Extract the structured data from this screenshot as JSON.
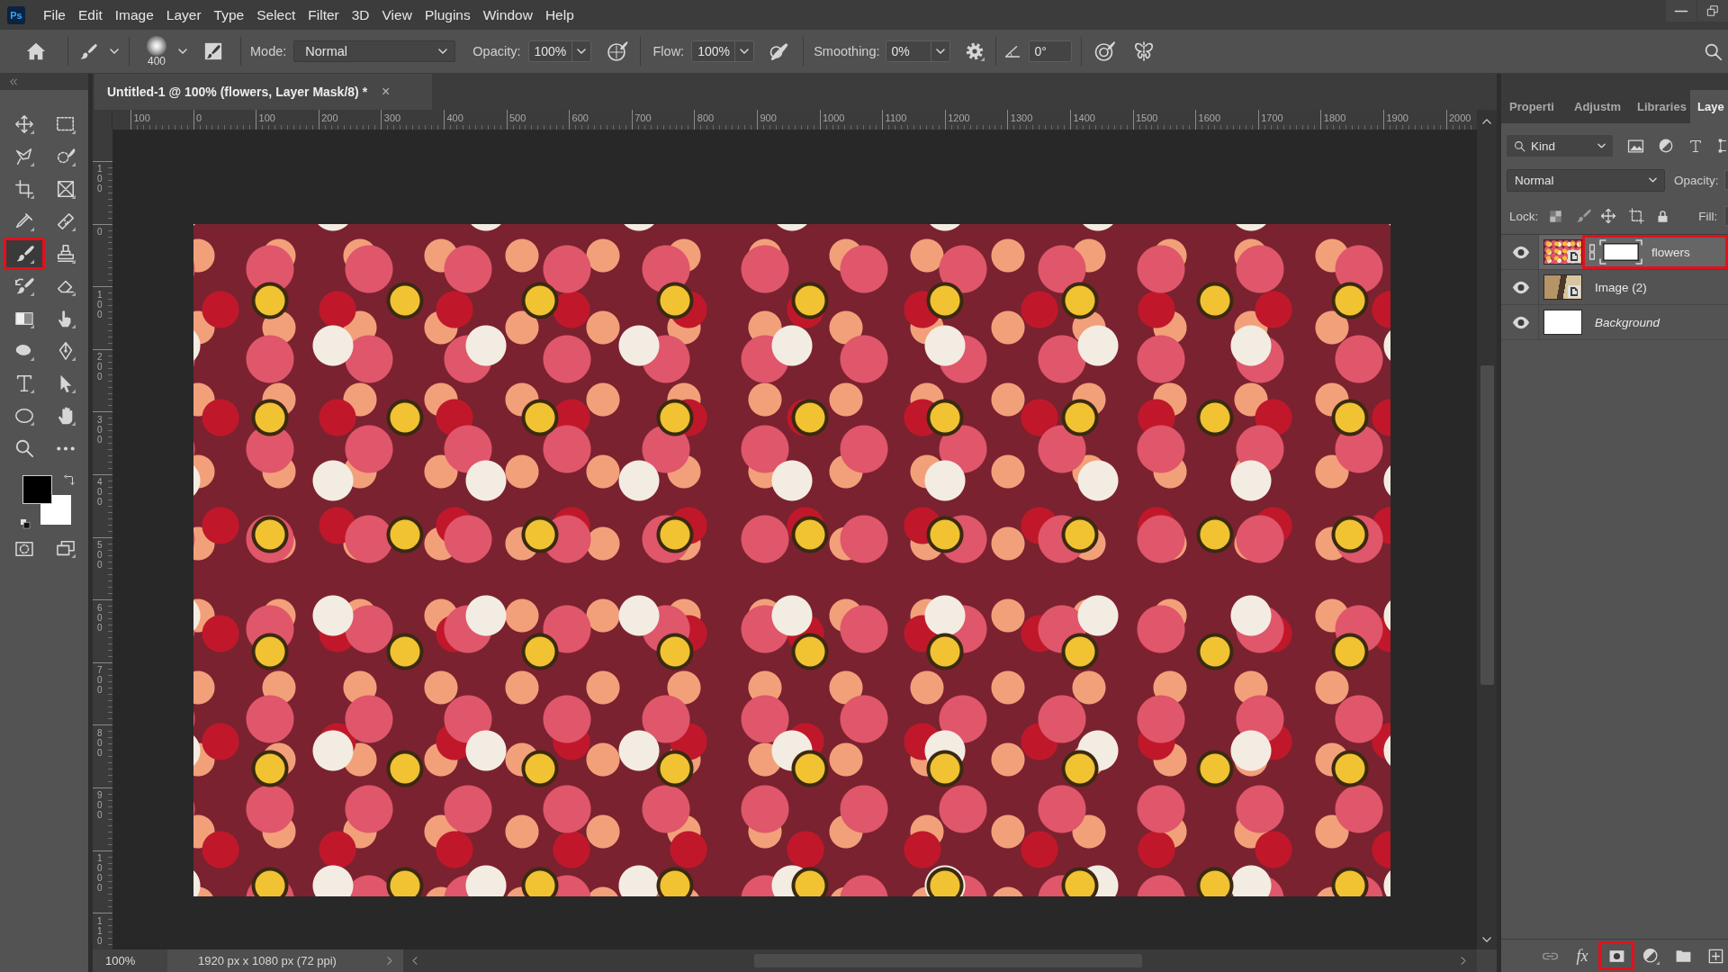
{
  "app_icon": {
    "label": "Ps"
  },
  "menu_bar": {
    "items": [
      "File",
      "Edit",
      "Image",
      "Layer",
      "Type",
      "Select",
      "Filter",
      "3D",
      "View",
      "Plugins",
      "Window",
      "Help"
    ]
  },
  "options_bar": {
    "brush_size": "400",
    "mode": {
      "label": "Mode:",
      "value": "Normal"
    },
    "opacity": {
      "label": "Opacity:",
      "value": "100%"
    },
    "flow": {
      "label": "Flow:",
      "value": "100%"
    },
    "smoothing": {
      "label": "Smoothing:",
      "value": "0%"
    },
    "angle": {
      "value": "0°"
    }
  },
  "toolbar": {
    "tools": [
      {
        "kind": "move",
        "selected": false,
        "highlighted": false
      },
      {
        "kind": "marquee",
        "selected": false,
        "highlighted": false
      },
      {
        "kind": "lasso",
        "selected": false,
        "highlighted": false
      },
      {
        "kind": "quick_select",
        "selected": false,
        "highlighted": false
      },
      {
        "kind": "crop",
        "selected": false,
        "highlighted": false
      },
      {
        "kind": "frame",
        "selected": false,
        "highlighted": false
      },
      {
        "kind": "eyedropper",
        "selected": false,
        "highlighted": false
      },
      {
        "kind": "healing",
        "selected": false,
        "highlighted": false
      },
      {
        "kind": "brush",
        "selected": true,
        "highlighted": true
      },
      {
        "kind": "stamp",
        "selected": false,
        "highlighted": false
      },
      {
        "kind": "history_brush",
        "selected": false,
        "highlighted": false
      },
      {
        "kind": "eraser",
        "selected": false,
        "highlighted": false
      },
      {
        "kind": "gradient",
        "selected": false,
        "highlighted": false
      },
      {
        "kind": "smudge",
        "selected": false,
        "highlighted": false
      },
      {
        "kind": "blob",
        "selected": false,
        "highlighted": false
      },
      {
        "kind": "pen",
        "selected": false,
        "highlighted": false
      },
      {
        "kind": "type",
        "selected": false,
        "highlighted": false
      },
      {
        "kind": "path_select",
        "selected": false,
        "highlighted": false
      },
      {
        "kind": "ellipse",
        "selected": false,
        "highlighted": false
      },
      {
        "kind": "hand",
        "selected": false,
        "highlighted": false
      },
      {
        "kind": "zoom",
        "selected": false,
        "highlighted": false
      },
      {
        "kind": "more",
        "selected": false,
        "highlighted": false
      }
    ]
  },
  "document_tab": {
    "title": "Untitled-1 @ 100% (flowers, Layer Mask/8) *",
    "close": "×"
  },
  "horizontal_ruler": {
    "labels": [
      "100",
      "0",
      "100",
      "200",
      "300",
      "400",
      "500",
      "600",
      "700",
      "800",
      "900",
      "1000",
      "1100",
      "1200",
      "1300",
      "1400",
      "1500",
      "1600",
      "1700",
      "1800",
      "1900",
      "2000"
    ]
  },
  "vertical_ruler": {
    "labels": [
      "100",
      "0",
      "100",
      "200",
      "300",
      "400",
      "500",
      "600",
      "700",
      "800",
      "900",
      "1000",
      "110"
    ]
  },
  "status_bar": {
    "zoom": "100%",
    "info": "1920 px x 1080 px (72 ppi)"
  },
  "panel": {
    "tabs": [
      {
        "label": "Properti",
        "selected": false
      },
      {
        "label": "Adjustm",
        "selected": false
      },
      {
        "label": "Libraries",
        "selected": false
      },
      {
        "label": "Laye",
        "selected": true
      }
    ],
    "filter": {
      "value": "Kind"
    },
    "blend_mode": {
      "value": "Normal"
    },
    "opacity_label": "Opacity:",
    "lock_label": "Lock:",
    "fill_label": "Fill:",
    "layers": [
      {
        "name": "flowers",
        "kind": "masked",
        "visible": true,
        "selected": true,
        "highlighted": true
      },
      {
        "name": "Image (2)",
        "kind": "smart",
        "visible": true,
        "selected": false,
        "highlighted": false
      },
      {
        "name": "Background",
        "kind": "background",
        "visible": true,
        "selected": false,
        "highlighted": false
      }
    ],
    "footer_buttons": [
      {
        "kind": "link",
        "disabled": true,
        "highlighted": false
      },
      {
        "kind": "fx",
        "label": "fx",
        "disabled": false,
        "highlighted": false
      },
      {
        "kind": "mask",
        "disabled": false,
        "highlighted": true
      },
      {
        "kind": "adjustment",
        "disabled": false,
        "highlighted": false
      },
      {
        "kind": "group",
        "disabled": false,
        "highlighted": false
      },
      {
        "kind": "new",
        "disabled": false,
        "highlighted": false
      }
    ]
  }
}
